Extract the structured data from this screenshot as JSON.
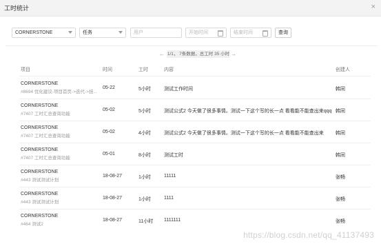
{
  "dialog": {
    "title": "工时统计",
    "close_icon": "×"
  },
  "filters": {
    "project_value": "CORNERSTONE",
    "type_value": "任务",
    "user_placeholder": "用户",
    "start_placeholder": "开始时间",
    "end_placeholder": "结束时间",
    "query_label": "查询"
  },
  "pager": {
    "prev": "←",
    "next": "→",
    "summary": "1/1， 7条数据，总工时 35 小时"
  },
  "table": {
    "headers": {
      "project": "项目",
      "time": "时间",
      "hours": "工时",
      "content": "内容",
      "creator": "创建人"
    },
    "rows": [
      {
        "project": "CORNERSTONE",
        "task": "#8694 优化建议-项目首页->迭代->挂...",
        "time": "05-22",
        "hours": "5小时",
        "content": "测试工作时间",
        "creator": "韩同"
      },
      {
        "project": "CORNERSTONE",
        "task": "#7407 工时汇总查询功能",
        "time": "05-02",
        "hours": "5小时",
        "content": "测试公式2 今天做了很多事情。测试一下这个写的长一点 看看能不能查出来qqq",
        "creator": "韩同"
      },
      {
        "project": "CORNERSTONE",
        "task": "#7407 工时汇总查询功能",
        "time": "05-02",
        "hours": "4小时",
        "content": "测试公式2 今天做了很多事情。测试一下这个写的长一点 看看能不能查出来",
        "creator": "韩同"
      },
      {
        "project": "CORNERSTONE",
        "task": "#7407 工时汇总查询功能",
        "time": "05-01",
        "hours": "8小时",
        "content": "测试工时",
        "creator": "韩同"
      },
      {
        "project": "CORNERSTONE",
        "task": "#443 测试测试计划",
        "time": "18-08-27",
        "hours": "1小时",
        "content": "11111",
        "creator": "张畅"
      },
      {
        "project": "CORNERSTONE",
        "task": "#443 测试测试计划",
        "time": "18-08-27",
        "hours": "1小时",
        "content": "1111",
        "creator": "张畅"
      },
      {
        "project": "CORNERSTONE",
        "task": "#464 测试2",
        "time": "18-08-27",
        "hours": "11小时",
        "content": "1111111",
        "creator": "张畅"
      }
    ]
  },
  "watermark": "https://blog.csdn.net/qq_41137493"
}
